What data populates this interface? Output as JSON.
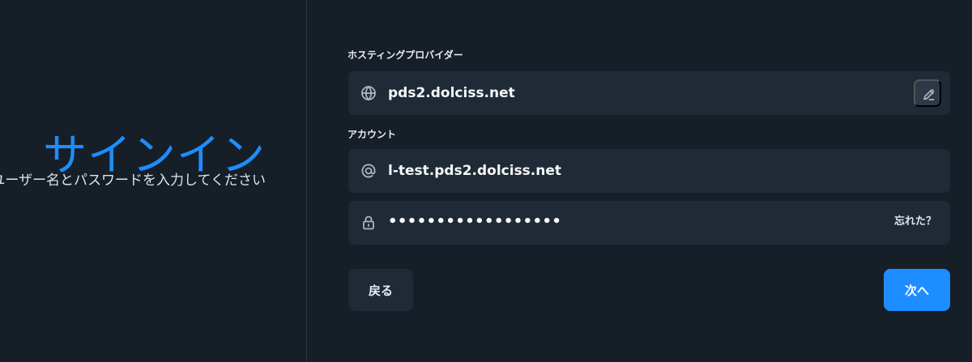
{
  "colors": {
    "background": "#161e27",
    "panel": "#1f2a36",
    "accent": "#1d8dff",
    "divider": "#2c3643",
    "text": "#f5f7fa",
    "muted_text": "#dde4ec"
  },
  "left": {
    "title": "サインイン",
    "subtitle": "ユーザー名とパスワードを入力してください"
  },
  "hosting": {
    "label": "ホスティングプロバイダー",
    "value": "pds2.dolciss.net",
    "icon": "globe-icon",
    "edit_icon": "pencil-icon"
  },
  "account": {
    "label": "アカウント",
    "username": "l-test.pds2.dolciss.net",
    "username_icon": "at-sign-icon",
    "password_masked": "••••••••••••••••••",
    "password_icon": "lock-icon",
    "forgot_label": "忘れた？"
  },
  "actions": {
    "back_label": "戻る",
    "next_label": "次へ"
  }
}
